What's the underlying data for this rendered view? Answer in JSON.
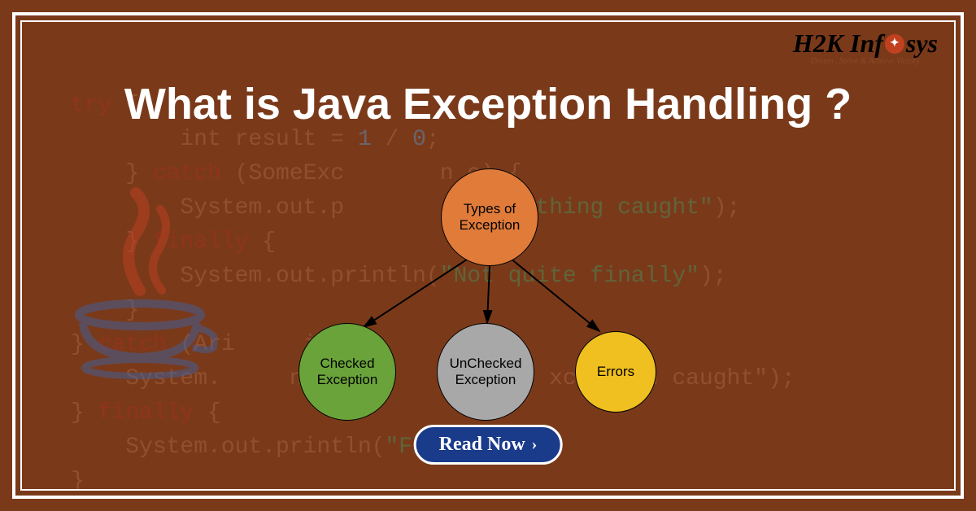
{
  "title": "What is Java Exception Handling ?",
  "brand": {
    "name_prefix": "H2K Inf",
    "name_suffix": "sys",
    "tagline": "Dream , Strive & Achieve Victory"
  },
  "code": {
    "line1_kw": "try",
    "line1_rest": " {",
    "line2": "        int result = ",
    "line2_n1": "1",
    "line2_div": " / ",
    "line2_n2": "0",
    "line2_end": ";",
    "line3a": "    } ",
    "line3_kw": "catch",
    "line3b": " (SomeExc       n e) {",
    "line4": "        System.out.p        (",
    "line4_str": "\"Something caught\"",
    "line4_end": ");",
    "line5a": "    } ",
    "line5_kw": "finally",
    "line5b": " {",
    "line6": "        System.out.println(",
    "line6_str": "\"Not quite finally\"",
    "line6_end": ");",
    "line7": "    }",
    "line8a": "} ",
    "line8_kw": "catch",
    "line8b": " (Ari     icE        n",
    "line9": "    System.     nt           h     xception caught\");",
    "line10a": "} ",
    "line10_kw": "finally",
    "line10b": " {",
    "line11": "    System.out.println(",
    "line11_str": "\"Finally\"",
    "line11_end": ");",
    "line12": "}"
  },
  "diagram": {
    "root": "Types of Exception",
    "children": [
      {
        "label": "Checked Exception"
      },
      {
        "label": "UnChecked Exception"
      },
      {
        "label": "Errors"
      }
    ]
  },
  "cta": "Read Now",
  "chart_data": {
    "type": "tree",
    "title": "Types of Exception",
    "root": "Types of Exception",
    "children": [
      "Checked Exception",
      "UnChecked Exception",
      "Errors"
    ],
    "colors": {
      "root": "#e07b3a",
      "Checked Exception": "#6aa33a",
      "UnChecked Exception": "#a8a8a8",
      "Errors": "#f0c020"
    }
  }
}
